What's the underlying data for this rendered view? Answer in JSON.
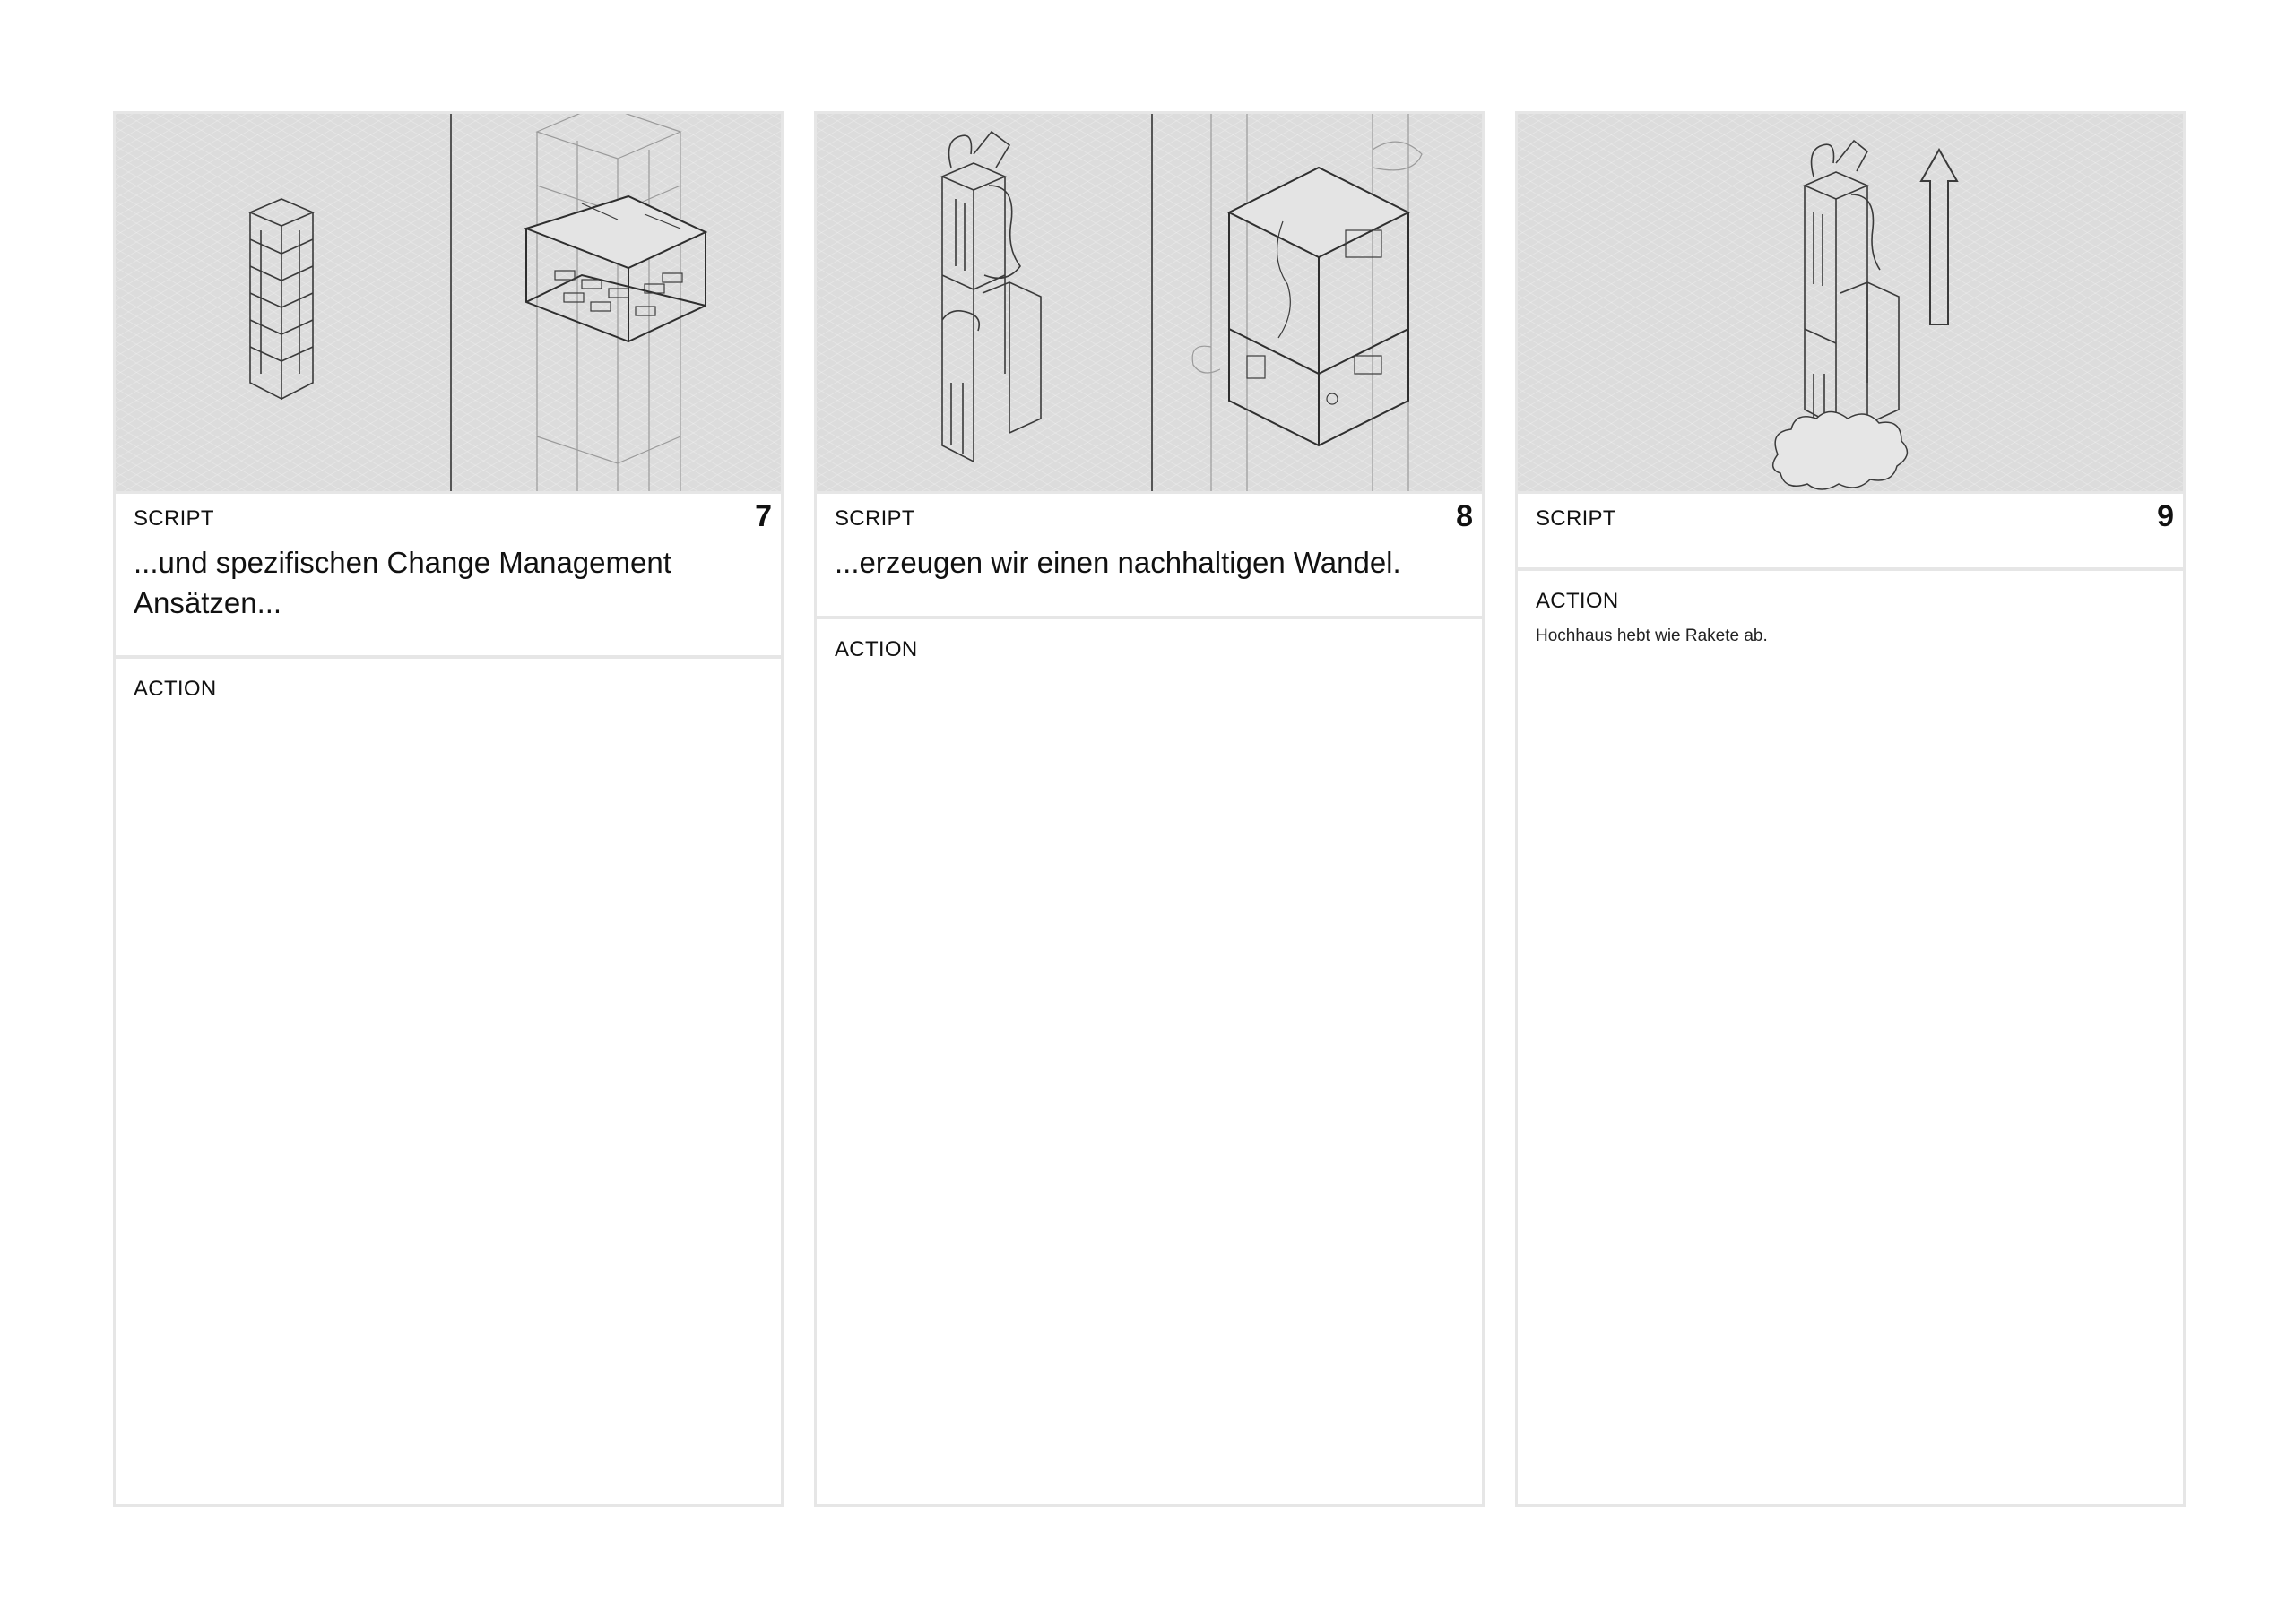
{
  "panels": [
    {
      "number": "7",
      "script_label": "SCRIPT",
      "script_text": "...und spezifischen Change Management Ansätzen...",
      "action_label": "ACTION",
      "action_text": "",
      "frame_illustration": "split-building-and-office-interior"
    },
    {
      "number": "8",
      "script_label": "SCRIPT",
      "script_text": "...erzeugen wir einen nachhaltigen Wandel.",
      "action_label": "ACTION",
      "action_text": "",
      "frame_illustration": "split-green-tower-and-open-interior"
    },
    {
      "number": "9",
      "script_label": "SCRIPT",
      "script_text": "",
      "action_label": "ACTION",
      "action_text": "Hochhaus hebt wie Rakete ab.",
      "frame_illustration": "tower-launching-with-arrow"
    }
  ],
  "colors": {
    "frame_bg": "#dcdcdc",
    "border": "#e6e6e6",
    "line": "#3a3a3a"
  }
}
